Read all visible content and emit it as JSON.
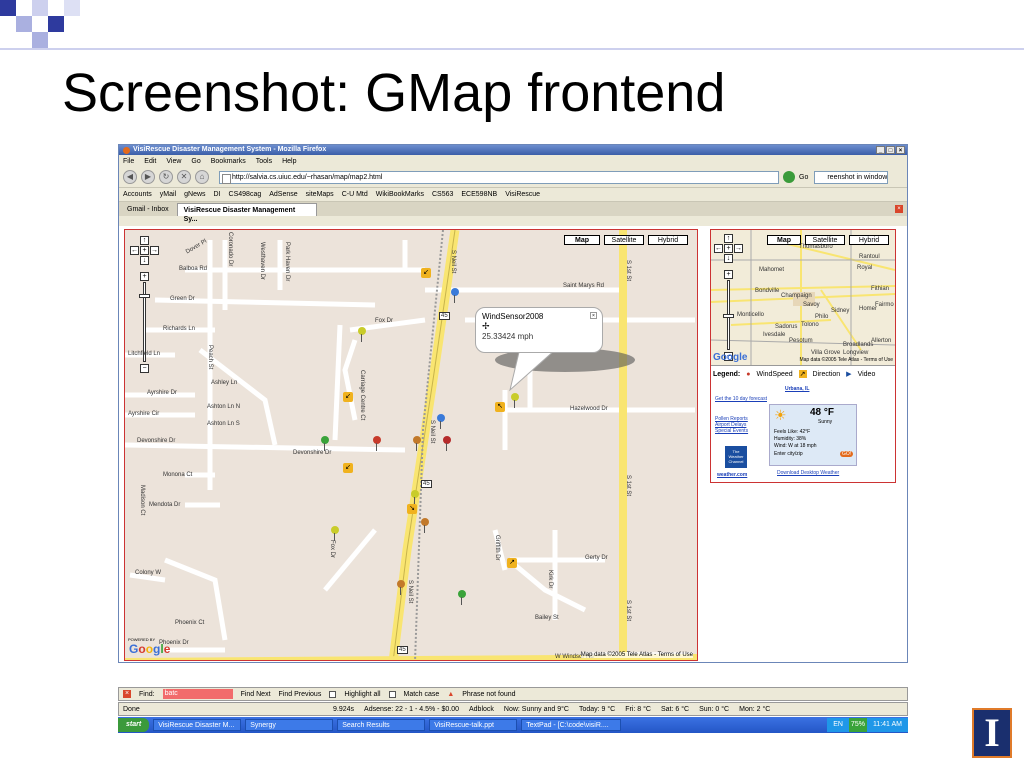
{
  "slide": {
    "title": "Screenshot: GMap frontend"
  },
  "browser": {
    "window_title": "VisiRescue Disaster Management System - Mozilla Firefox",
    "menu": [
      "File",
      "Edit",
      "View",
      "Go",
      "Bookmarks",
      "Tools",
      "Help"
    ],
    "url": "http://salvia.cs.uiuc.edu/~rhasan/map/map2.html",
    "go_label": "Go",
    "search_value": "reenshot in windows",
    "bookmarks": [
      "Accounts",
      "yMail",
      "gNews",
      "DI",
      "CS498cag",
      "AdSense",
      "siteMaps",
      "C-U Mtd",
      "WikiBookMarks",
      "CS563",
      "ECE598NB",
      "VisiRescue"
    ],
    "tabs": [
      "Gmail - Inbox",
      "VisiRescue Disaster Management Sy..."
    ]
  },
  "map": {
    "types": [
      "Map",
      "Satellite",
      "Hybrid"
    ],
    "streets": {
      "dover_pl": "Dover Pl",
      "balboa": "Balboa Rd",
      "green": "Green Dr",
      "richards": "Richards Ln",
      "litchfield": "Litchfield Ln",
      "ayrshire_dr": "Ayrshire Dr",
      "ayrshire_cir": "Ayrshire Cir",
      "devonshire": "Devonshire Dr",
      "devonshire2": "Devonshire Dr",
      "monona": "Monona Ct",
      "mendota": "Mendota Dr",
      "phoenix": "Phoenix Dr",
      "ashley": "Ashley Ln",
      "ashton_n": "Ashton Ln N",
      "ashton_s": "Ashton Ln S",
      "fox": "Fox Dr",
      "saint_marys": "Saint Marys Rd",
      "hazelwood": "Hazelwood Dr",
      "gerty": "Gerty Dr",
      "bailey": "Bailey St",
      "windsor": "W Windsor Rd",
      "s_neil": "S Neil St",
      "s_1st": "S 1st St",
      "coronado": "Coronado Dr",
      "westhaven": "Westhaven Dr",
      "park_haven": "Park Haven Dr",
      "peach": "Peach St",
      "carriage": "Carriage Centre Ct",
      "fox_v": "Fox Dr",
      "griffith": "Griffith Dr",
      "kirk": "Kirk Dr",
      "madison": "Madison Ct",
      "phoenix_ct": "Phoenix Ct",
      "colony": "Colony W",
      "hwy_45": "45"
    },
    "info_window": {
      "title": "WindSensor2008",
      "value": "25.33424 mph"
    },
    "powered_by": "POWERED BY",
    "google": "Google",
    "copyright": "Map data ©2005 Tele Atlas - Terms of Use"
  },
  "side": {
    "minimap": {
      "types": [
        "Map",
        "Satellite",
        "Hybrid"
      ],
      "places": [
        "Thomasboro",
        "Royal",
        "Rantoul",
        "Mahomet",
        "Bondville",
        "Champaign",
        "Savoy",
        "Sidney",
        "Homer",
        "Fithian",
        "Fairmo",
        "Philo",
        "Tolono",
        "Ivesdale",
        "Sadorus",
        "Pesotum",
        "Broadlands",
        "Allerton",
        "Longview",
        "Villa Grove",
        "Monticello"
      ],
      "copyright": "Map data ©2005 Tele Atlas - Terms of Use",
      "google": "Google"
    },
    "legend": {
      "label": "Legend:",
      "items": [
        "WindSpeed",
        "Direction",
        "Video"
      ]
    },
    "weather": {
      "city": "Urbana, IL",
      "forecast_link": "Get the 10 day forecast",
      "links": [
        "Pollen Reports",
        "Airport Delays",
        "Special Events"
      ],
      "temp": "48 °F",
      "condition": "Sunny",
      "feels": "Feels Like: 42°F",
      "humidity": "Humidity: 38%",
      "wind": "Wind: W at 18 mph",
      "enter": "Enter city/zip",
      "go": "GO!",
      "logo": "The Weather Channel",
      "site": "weather.com",
      "download": "Download Desktop Weather"
    }
  },
  "findbar": {
    "label": "Find:",
    "value": "batc",
    "next": "Find Next",
    "previous": "Find Previous",
    "highlight": "Highlight all",
    "match_case": "Match case",
    "status": "Phrase not found"
  },
  "statusbar": {
    "done": "Done",
    "time": "9.924s",
    "adsense": "Adsense: 22 - 1 - 4.5% - $0.00",
    "adblock": "Adblock",
    "now": "Now: Sunny and 9°C",
    "today": "Today: 9 °C",
    "fri": "Fri: 8 °C",
    "sat": "Sat: 6 °C",
    "sun": "Sun: 0 °C",
    "mon": "Mon: 2 °C"
  },
  "taskbar": {
    "start": "start",
    "items": [
      "VisiRescue Disaster M...",
      "Synergy",
      "Search Results",
      "VisiRescue-talk.ppt",
      "TextPad - [C:\\code\\visiR...."
    ],
    "lang": "EN",
    "battery": "75%",
    "clock": "11:41 AM"
  },
  "colors": {
    "accent_blue": "#1a2f6e",
    "deco_blue": "#2e3a9e",
    "deco_light": "#aab0e0",
    "road_yellow": "#f9e571",
    "map_bg": "#ece3da"
  }
}
